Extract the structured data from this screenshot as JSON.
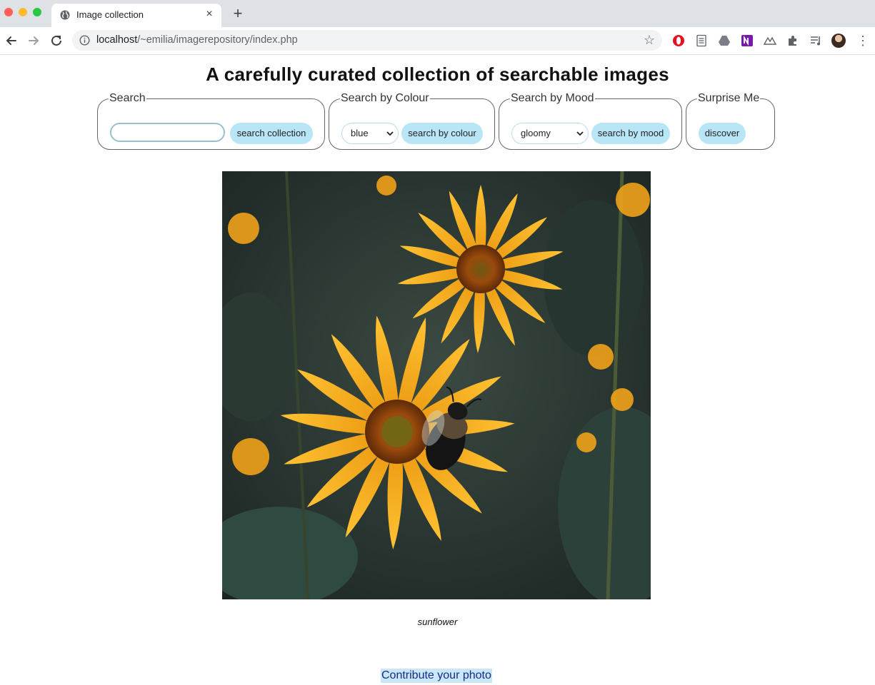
{
  "browser": {
    "tab_title": "Image collection",
    "tab_close": "×",
    "new_tab": "+",
    "url_host": "localhost",
    "url_path": "/~emilia/imagerepository/index.php",
    "star": "☆",
    "menu": "⋮",
    "icons": [
      "back-arrow-icon",
      "forward-arrow-icon",
      "reload-icon",
      "info-icon",
      "opera-icon",
      "page-icon",
      "drive-icon",
      "onenote-icon",
      "mountain-icon",
      "puzzle-extension-icon",
      "reading-list-icon",
      "profile-avatar"
    ]
  },
  "page": {
    "title": "A carefully curated collection of searchable images",
    "search": {
      "legend": "Search",
      "placeholder": "",
      "button": "search collection"
    },
    "colour": {
      "legend": "Search by Colour",
      "selected": "blue",
      "button": "search by colour"
    },
    "mood": {
      "legend": "Search by Mood",
      "selected": "gloomy",
      "button": "search by mood"
    },
    "surprise": {
      "legend": "Surprise Me",
      "button": "discover"
    },
    "image_caption": "sunflower",
    "contribute": "Contribute your photo"
  },
  "colors": {
    "pill_bg": "#b8e6f7",
    "link_highlight": "#c9e7f5",
    "link_text": "#1a2a8a",
    "petal": "#f4a91c",
    "background_foliage": "#23302c"
  }
}
